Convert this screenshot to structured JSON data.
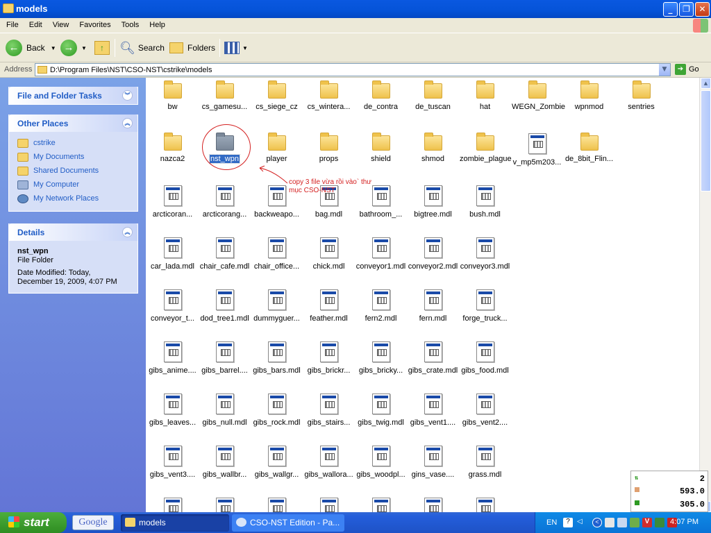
{
  "window": {
    "title": "models"
  },
  "menu": [
    "File",
    "Edit",
    "View",
    "Favorites",
    "Tools",
    "Help"
  ],
  "toolbar": {
    "back_label": "Back",
    "search_label": "Search",
    "folders_label": "Folders"
  },
  "address": {
    "label": "Address",
    "path": "D:\\Program Files\\NST\\CSO-NST\\cstrike\\models",
    "go_label": "Go"
  },
  "sidebar": {
    "file_tasks_title": "File and Folder Tasks",
    "other_places_title": "Other Places",
    "other_places": [
      "cstrike",
      "My Documents",
      "Shared Documents",
      "My Computer",
      "My Network Places"
    ],
    "details_title": "Details",
    "details_name": "nst_wpn",
    "details_type": "File Folder",
    "details_modified_1": "Date Modified: Today,",
    "details_modified_2": "December 19, 2009, 4:07 PM"
  },
  "files": [
    {
      "name": "bw",
      "type": "folder"
    },
    {
      "name": "cs_gamesu...",
      "type": "folder"
    },
    {
      "name": "cs_siege_cz",
      "type": "folder"
    },
    {
      "name": "cs_wintera...",
      "type": "folder"
    },
    {
      "name": "de_contra",
      "type": "folder"
    },
    {
      "name": "de_tuscan",
      "type": "folder"
    },
    {
      "name": "hat",
      "type": "folder"
    },
    {
      "name": "WEGN_Zombie",
      "type": "folder"
    },
    {
      "name": "wpnmod",
      "type": "folder"
    },
    {
      "name": "sentries",
      "type": "folder"
    },
    {
      "name": "nazca2",
      "type": "folder"
    },
    {
      "name": "nst_wpn",
      "type": "folder",
      "selected": true
    },
    {
      "name": "player",
      "type": "folder"
    },
    {
      "name": "props",
      "type": "folder"
    },
    {
      "name": "shield",
      "type": "folder"
    },
    {
      "name": "shmod",
      "type": "folder"
    },
    {
      "name": "zombie_plague",
      "type": "folder"
    },
    {
      "name": "v_mp5m203...",
      "type": "file"
    },
    {
      "name": "de_8bit_Flin...",
      "type": "folder"
    },
    {
      "name": "",
      "type": "none"
    },
    {
      "name": "arcticoran...",
      "type": "file"
    },
    {
      "name": "arcticorang...",
      "type": "file"
    },
    {
      "name": "backweapo...",
      "type": "file"
    },
    {
      "name": "bag.mdl",
      "type": "file"
    },
    {
      "name": "bathroom_...",
      "type": "file"
    },
    {
      "name": "bigtree.mdl",
      "type": "file"
    },
    {
      "name": "bush.mdl",
      "type": "file"
    },
    {
      "name": "",
      "type": "none"
    },
    {
      "name": "",
      "type": "none"
    },
    {
      "name": "",
      "type": "none"
    },
    {
      "name": "car_lada.mdl",
      "type": "file"
    },
    {
      "name": "chair_cafe.mdl",
      "type": "file"
    },
    {
      "name": "chair_office...",
      "type": "file"
    },
    {
      "name": "chick.mdl",
      "type": "file"
    },
    {
      "name": "conveyor1.mdl",
      "type": "file"
    },
    {
      "name": "conveyor2.mdl",
      "type": "file"
    },
    {
      "name": "conveyor3.mdl",
      "type": "file"
    },
    {
      "name": "",
      "type": "none"
    },
    {
      "name": "",
      "type": "none"
    },
    {
      "name": "",
      "type": "none"
    },
    {
      "name": "conveyor_t...",
      "type": "file"
    },
    {
      "name": "dod_tree1.mdl",
      "type": "file"
    },
    {
      "name": "dummyguer...",
      "type": "file"
    },
    {
      "name": "feather.mdl",
      "type": "file"
    },
    {
      "name": "fern2.mdl",
      "type": "file"
    },
    {
      "name": "fern.mdl",
      "type": "file"
    },
    {
      "name": "forge_truck...",
      "type": "file"
    },
    {
      "name": "",
      "type": "none"
    },
    {
      "name": "",
      "type": "none"
    },
    {
      "name": "",
      "type": "none"
    },
    {
      "name": "gibs_anime....",
      "type": "file"
    },
    {
      "name": "gibs_barrel....",
      "type": "file"
    },
    {
      "name": "gibs_bars.mdl",
      "type": "file"
    },
    {
      "name": "gibs_brickr...",
      "type": "file"
    },
    {
      "name": "gibs_bricky...",
      "type": "file"
    },
    {
      "name": "gibs_crate.mdl",
      "type": "file"
    },
    {
      "name": "gibs_food.mdl",
      "type": "file"
    },
    {
      "name": "",
      "type": "none"
    },
    {
      "name": "",
      "type": "none"
    },
    {
      "name": "",
      "type": "none"
    },
    {
      "name": "gibs_leaves...",
      "type": "file"
    },
    {
      "name": "gibs_null.mdl",
      "type": "file"
    },
    {
      "name": "gibs_rock.mdl",
      "type": "file"
    },
    {
      "name": "gibs_stairs...",
      "type": "file"
    },
    {
      "name": "gibs_twig.mdl",
      "type": "file"
    },
    {
      "name": "gibs_vent1....",
      "type": "file"
    },
    {
      "name": "gibs_vent2....",
      "type": "file"
    },
    {
      "name": "",
      "type": "none"
    },
    {
      "name": "",
      "type": "none"
    },
    {
      "name": "",
      "type": "none"
    },
    {
      "name": "gibs_vent3....",
      "type": "file"
    },
    {
      "name": "gibs_wallbr...",
      "type": "file"
    },
    {
      "name": "gibs_wallgr...",
      "type": "file"
    },
    {
      "name": "gibs_wallora...",
      "type": "file"
    },
    {
      "name": "gibs_woodpl...",
      "type": "file"
    },
    {
      "name": "gins_vase....",
      "type": "file"
    },
    {
      "name": "grass.mdl",
      "type": "file"
    },
    {
      "name": "",
      "type": "none"
    },
    {
      "name": "",
      "type": "none"
    },
    {
      "name": "",
      "type": "none"
    },
    {
      "name": "",
      "type": "file"
    },
    {
      "name": "",
      "type": "file"
    },
    {
      "name": "",
      "type": "file"
    },
    {
      "name": "",
      "type": "file"
    },
    {
      "name": "",
      "type": "file"
    },
    {
      "name": "",
      "type": "file"
    },
    {
      "name": "",
      "type": "file"
    }
  ],
  "annotation": {
    "line1": "copy 3 file vừa rồi vào` thư",
    "line2": "mục CSO-NST"
  },
  "widget": {
    "val1": "2",
    "val2": "593.0",
    "val3": "305.0"
  },
  "taskbar": {
    "start_label": "start",
    "google_label": "Google",
    "task1": "models",
    "task2": "CSO-NST Edition - Pa...",
    "lang": "EN",
    "clock": "4:07 PM"
  },
  "colors": {
    "xp_blue": "#0553d8",
    "sidebar_blue": "#6375d6",
    "selection": "#316ac5",
    "annotation_red": "#d42020",
    "start_green": "#3a9b2a"
  }
}
